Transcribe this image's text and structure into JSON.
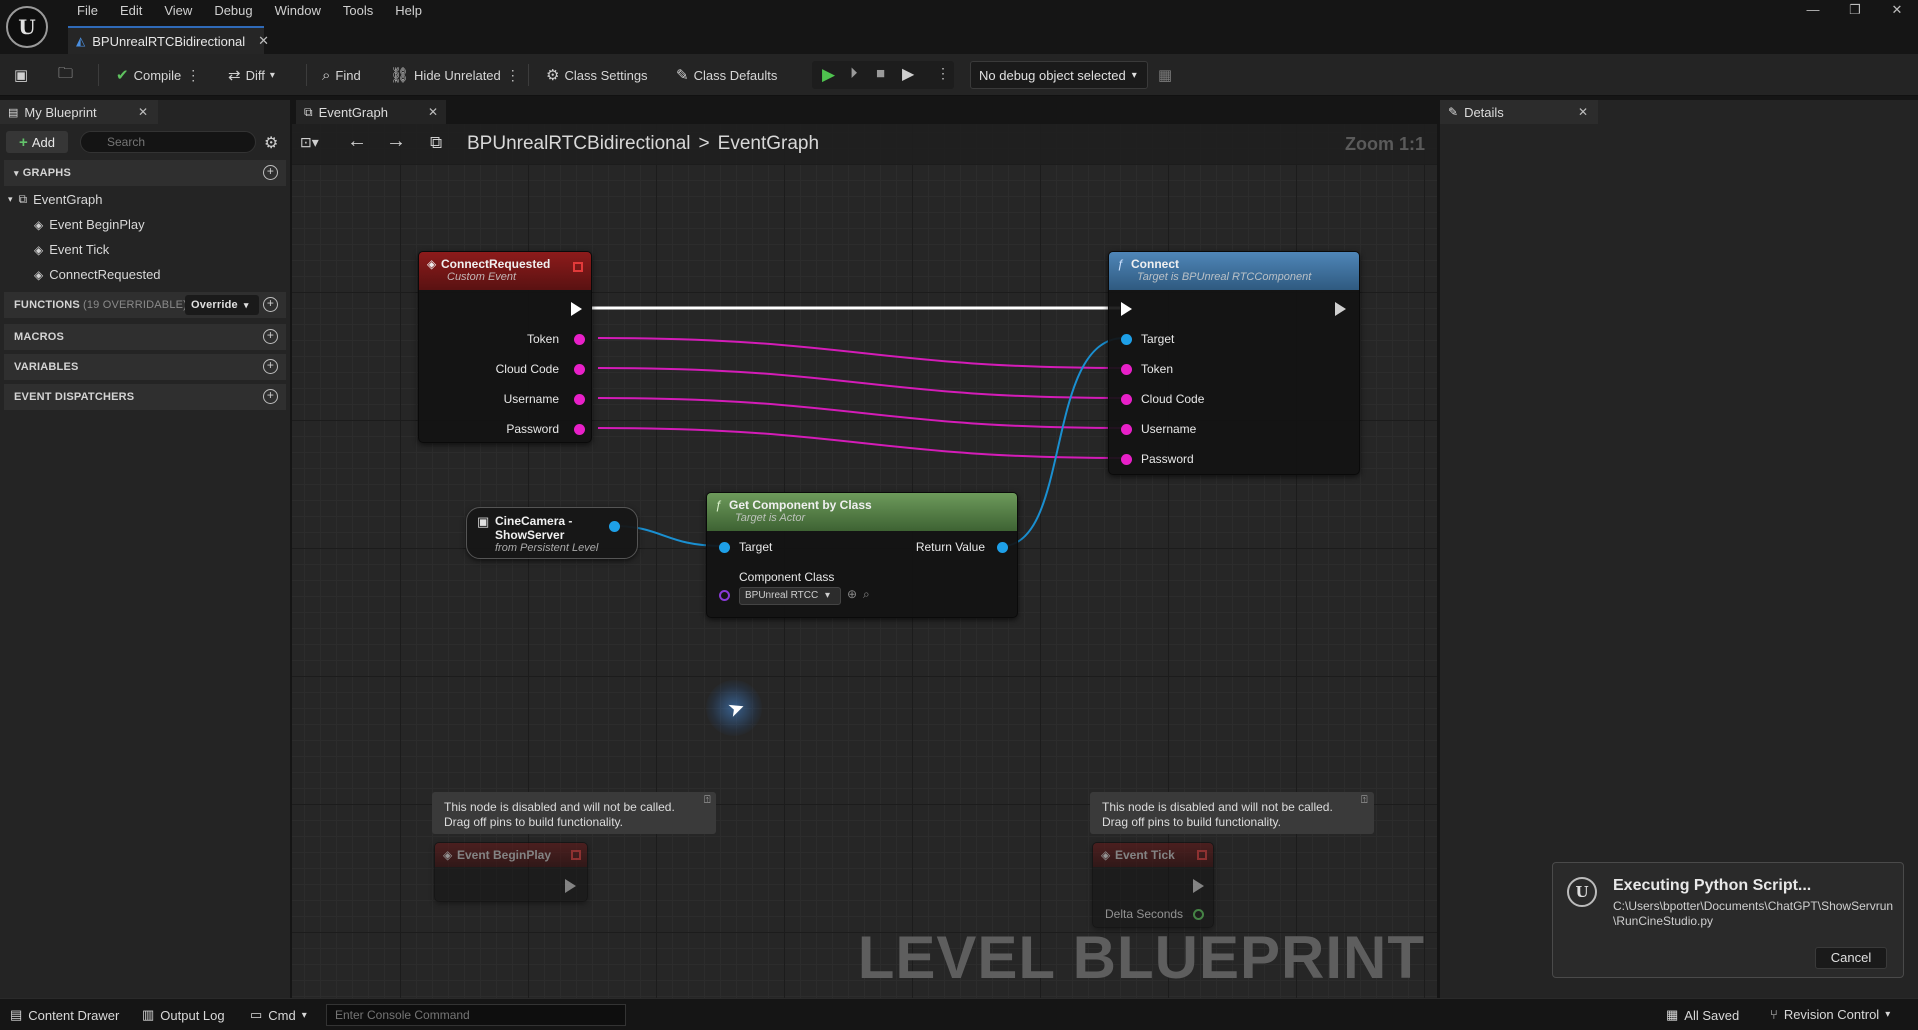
{
  "app": {
    "menu": [
      "File",
      "Edit",
      "View",
      "Debug",
      "Window",
      "Tools",
      "Help"
    ],
    "document_tab": "BPUnrealRTCBidirectional",
    "logo_letter": "U"
  },
  "toolbar": {
    "compile": "Compile",
    "diff": "Diff",
    "find": "Find",
    "hide_unrelated": "Hide Unrelated",
    "class_settings": "Class Settings",
    "class_defaults": "Class Defaults",
    "debug_object": "No debug object selected"
  },
  "left_panel": {
    "tab": "My Blueprint",
    "add": "Add",
    "search_placeholder": "Search",
    "graphs_header": "GRAPHS",
    "event_graph": "EventGraph",
    "events": [
      "Event BeginPlay",
      "Event Tick",
      "ConnectRequested"
    ],
    "functions_header": "FUNCTIONS",
    "functions_count": "(19 OVERRIDABLE)",
    "override": "Override",
    "macros_header": "MACROS",
    "variables_header": "VARIABLES",
    "dispatchers_header": "EVENT DISPATCHERS"
  },
  "graph": {
    "tab": "EventGraph",
    "breadcrumb_root": "BPUnrealRTCBidirectional",
    "breadcrumb_sep": ">",
    "breadcrumb_leaf": "EventGraph",
    "zoom": "Zoom 1:1",
    "watermark": "LEVEL BLUEPRINT",
    "nodes": {
      "connect_requested": {
        "title": "ConnectRequested",
        "subtitle": "Custom Event",
        "pins": [
          "Token",
          "Cloud Code",
          "Username",
          "Password"
        ]
      },
      "connect": {
        "title": "Connect",
        "subtitle": "Target is BPUnreal RTCComponent",
        "pins": [
          "Target",
          "Token",
          "Cloud Code",
          "Username",
          "Password"
        ]
      },
      "cinecamera": {
        "title_line1": "CineCamera -",
        "title_line2": "ShowServer",
        "subtitle": "from Persistent Level"
      },
      "get_component": {
        "title": "Get Component by Class",
        "subtitle": "Target is Actor",
        "target": "Target",
        "return_value": "Return Value",
        "component_class": "Component Class",
        "class_value": "BPUnreal RTCC"
      },
      "disabled_comment": "This node is disabled and will not be called. Drag off pins to build functionality.",
      "begin_play": {
        "title": "Event BeginPlay"
      },
      "tick": {
        "title": "Event Tick",
        "pin": "Delta Seconds"
      }
    }
  },
  "details_panel": {
    "tab": "Details"
  },
  "notification": {
    "title": "Executing Python Script...",
    "path": "C:\\Users\\bpotter\\Documents\\ChatGPT\\ShowServrun\\RunCineStudio.py",
    "cancel": "Cancel"
  },
  "statusbar": {
    "content_drawer": "Content Drawer",
    "output_log": "Output Log",
    "cmd": "Cmd",
    "console_placeholder": "Enter Console Command",
    "all_saved": "All Saved",
    "revision_control": "Revision Control"
  },
  "colors": {
    "event_header": "#8a1c1c",
    "function_header": "#4a7fae",
    "pure_function_header": "#5f8a4f",
    "string_pin": "#e820c8",
    "object_pin": "#1ea0e8",
    "accent": "#2f6ab8"
  }
}
